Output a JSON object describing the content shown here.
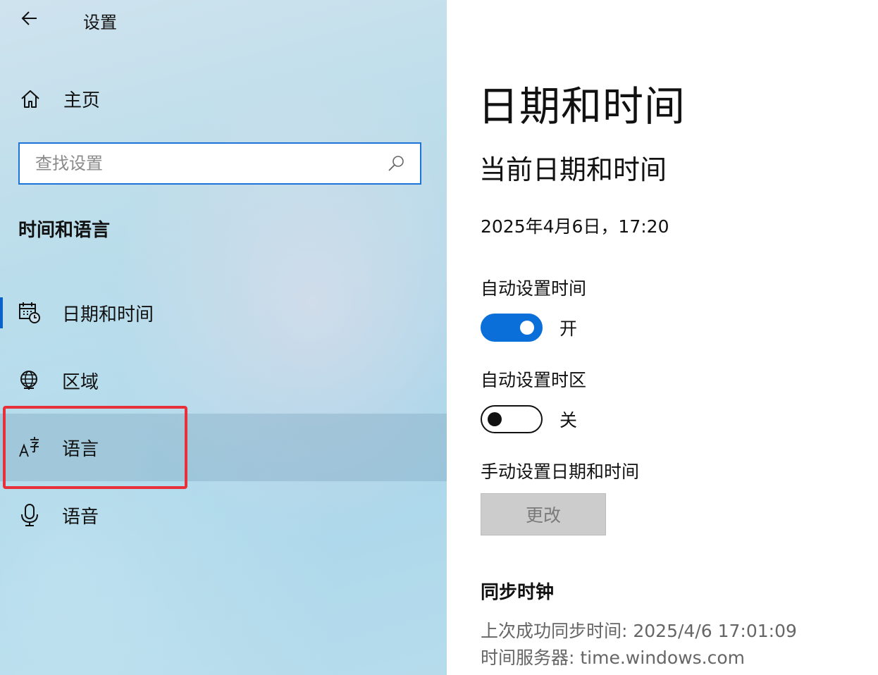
{
  "header": {
    "app_title": "设置"
  },
  "sidebar": {
    "home_label": "主页",
    "search": {
      "placeholder": "查找设置",
      "value": ""
    },
    "section_title": "时间和语言",
    "items": [
      {
        "label": "日期和时间",
        "icon": "calendar-clock-icon"
      },
      {
        "label": "区域",
        "icon": "globe-icon"
      },
      {
        "label": "语言",
        "icon": "language-icon"
      },
      {
        "label": "语音",
        "icon": "microphone-icon"
      }
    ]
  },
  "main": {
    "page_title": "日期和时间",
    "section_current": "当前日期和时间",
    "current_datetime": "2025年4月6日，17:20",
    "auto_time": {
      "label": "自动设置时间",
      "state_label": "开",
      "on": true
    },
    "auto_timezone": {
      "label": "自动设置时区",
      "state_label": "关",
      "on": false
    },
    "manual": {
      "label": "手动设置日期和时间",
      "button_label": "更改"
    },
    "sync": {
      "title": "同步时钟",
      "last_sync": "上次成功同步时间: 2025/4/6 17:01:09",
      "server": "时间服务器: time.windows.com"
    }
  },
  "colors": {
    "accent": "#0a6fd8",
    "highlight_box": "#e8303a",
    "disabled_button": "#cccccc"
  }
}
